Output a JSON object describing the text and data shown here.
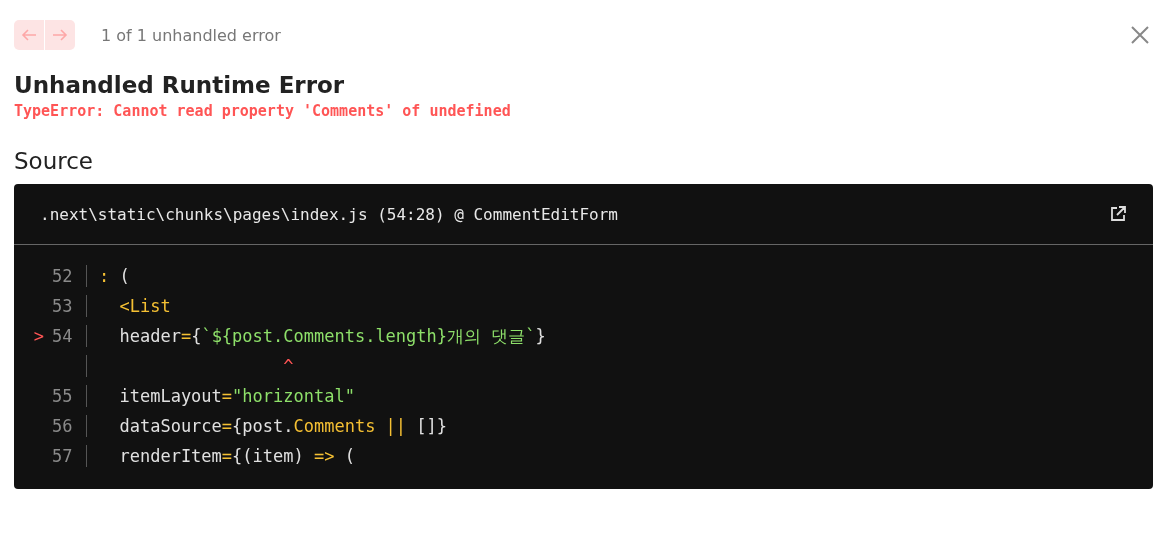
{
  "nav": {
    "buttons": [
      {
        "kind": "previous",
        "disabled": true
      },
      {
        "kind": "next",
        "disabled": true
      }
    ],
    "counter": "1 of 1 unhandled error"
  },
  "title": "Unhandled Runtime Error",
  "message": "TypeError: Cannot read property 'Comments' of undefined",
  "source": {
    "heading": "Source",
    "file": ".next\\static\\chunks\\pages\\index.js (54:28) @ CommentEditForm",
    "lines": [
      {
        "number": "52",
        "tokens": [
          {
            "kind": "keyword",
            "text": ": "
          },
          {
            "kind": "plain",
            "text": "("
          }
        ]
      },
      {
        "number": "53",
        "tokens": [
          {
            "kind": "keyword",
            "text": "  <List"
          }
        ]
      },
      {
        "number": "54",
        "marker": ">",
        "tokens": [
          {
            "kind": "plain",
            "text": "  header"
          },
          {
            "kind": "keyword",
            "text": "="
          },
          {
            "kind": "plain",
            "text": "{"
          },
          {
            "kind": "string",
            "text": "`${post.Comments.length}개의 댓글`"
          },
          {
            "kind": "plain",
            "text": "}"
          }
        ]
      },
      {
        "tokens": [
          {
            "kind": "caret",
            "text": "                  ^"
          }
        ]
      },
      {
        "number": "55",
        "tokens": [
          {
            "kind": "plain",
            "text": "  itemLayout"
          },
          {
            "kind": "keyword",
            "text": "="
          },
          {
            "kind": "string",
            "text": "\"horizontal\""
          }
        ]
      },
      {
        "number": "56",
        "tokens": [
          {
            "kind": "plain",
            "text": "  dataSource"
          },
          {
            "kind": "keyword",
            "text": "="
          },
          {
            "kind": "plain",
            "text": "{post."
          },
          {
            "kind": "keyword",
            "text": "Comments || "
          },
          {
            "kind": "plain",
            "text": "[]}"
          }
        ]
      },
      {
        "number": "57",
        "tokens": [
          {
            "kind": "plain",
            "text": "  renderItem"
          },
          {
            "kind": "keyword",
            "text": "="
          },
          {
            "kind": "plain",
            "text": "{(item) "
          },
          {
            "kind": "keyword",
            "text": "=>"
          },
          {
            "kind": "plain",
            "text": " ("
          }
        ]
      }
    ]
  }
}
